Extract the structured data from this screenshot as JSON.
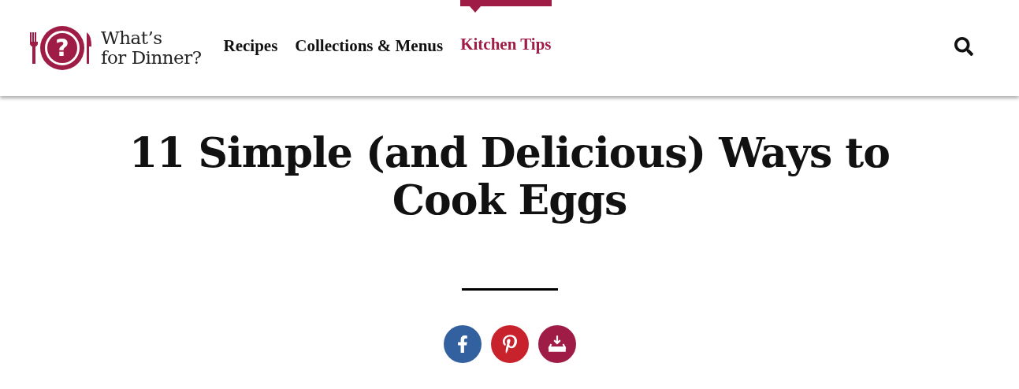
{
  "logo": {
    "mark": "?",
    "line1": "What’s",
    "line2": "for Dinner?"
  },
  "nav": [
    {
      "label": "Recipes",
      "selected": false
    },
    {
      "label": "Collections & Menus",
      "selected": false
    },
    {
      "label": "Kitchen Tips",
      "selected": true
    }
  ],
  "article": {
    "title": "11 Simple (and Delicious) Ways to Cook Eggs"
  },
  "share": [
    {
      "kind": "facebook"
    },
    {
      "kind": "pinterest"
    },
    {
      "kind": "save"
    }
  ]
}
